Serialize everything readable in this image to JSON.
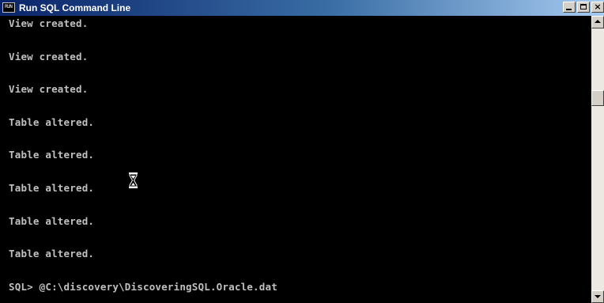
{
  "window": {
    "title": "Run SQL Command Line",
    "icon_text": "RUN",
    "icon_name": "sqlplus-app-icon"
  },
  "caption_buttons": {
    "minimize_icon": "minimize-icon",
    "maximize_icon": "maximize-icon",
    "close_icon": "close-icon"
  },
  "console": {
    "lines": [
      "View created.",
      "",
      "View created.",
      "",
      "View created.",
      "",
      "Table altered.",
      "",
      "Table altered.",
      "",
      "Table altered.",
      "",
      "Table altered.",
      "",
      "Table altered.",
      "",
      "SQL> @C:\\discovery\\DiscoveringSQL.Oracle.dat"
    ],
    "text_color": "#c0c0c0",
    "background_color": "#000000"
  },
  "scrollbar": {
    "up_icon": "scroll-up-arrow-icon",
    "down_icon": "scroll-down-arrow-icon",
    "position_fraction": 0.25
  },
  "cursor": {
    "icon": "hourglass-busy-cursor-icon"
  }
}
